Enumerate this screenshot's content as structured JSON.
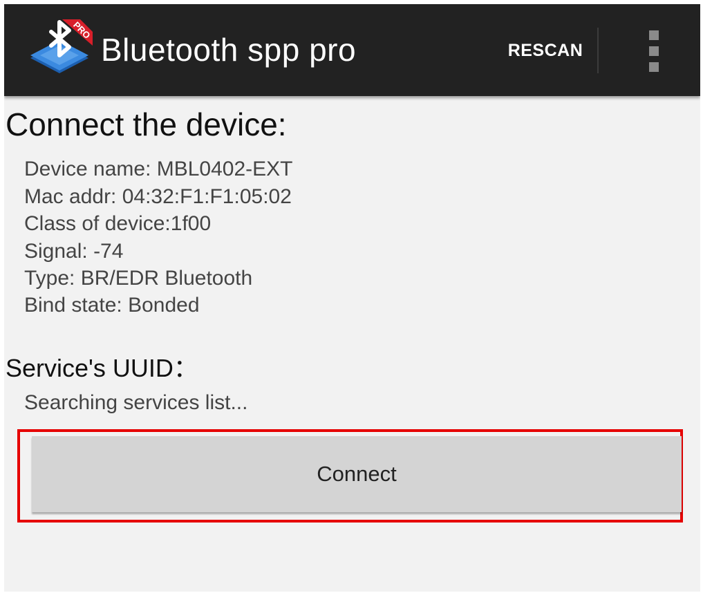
{
  "actionbar": {
    "title": "Bluetooth spp pro",
    "icon": "bluetooth-icon",
    "icon_badge": "PRO",
    "rescan_label": "RESCAN",
    "overflow_icon": "overflow-menu-icon"
  },
  "device": {
    "heading": "Connect the device:",
    "lines": [
      "Device name: MBL0402-EXT",
      "Mac addr: 04:32:F1:F1:05:02",
      "Class of device:1f00",
      "Signal: -74",
      "Type: BR/EDR Bluetooth",
      "Bind state: Bonded"
    ]
  },
  "service": {
    "heading": "Service's UUID：",
    "status": "Searching services list..."
  },
  "connect_label": "Connect",
  "colors": {
    "actionbar_bg": "#222222",
    "background": "#f2f2f2",
    "button_bg": "#d4d4d4",
    "highlight": "#e60000",
    "icon_blue": "#2f7fd8",
    "badge_red": "#d81f2a"
  }
}
